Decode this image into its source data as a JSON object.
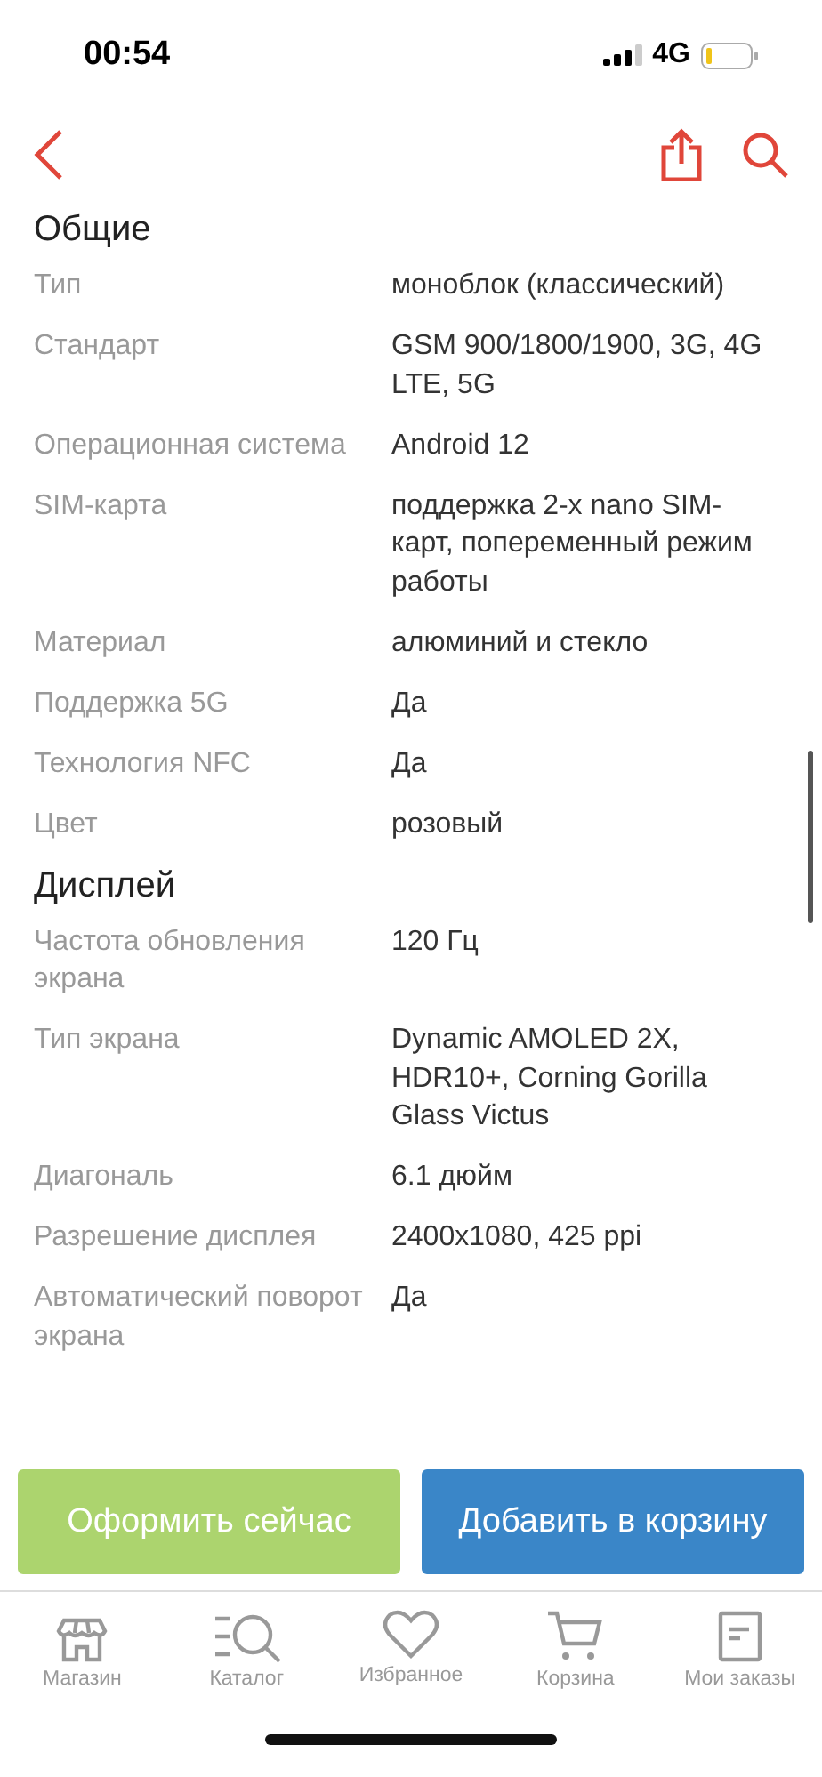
{
  "status_bar": {
    "time": "00:54",
    "network": "4G"
  },
  "sections": [
    {
      "title": "Общие",
      "rows": [
        {
          "label": "Тип",
          "value": "моноблок (классический)"
        },
        {
          "label": "Стандарт",
          "value": "GSM 900/1800/1900, 3G, 4G LTE, 5G"
        },
        {
          "label": "Операционная система",
          "value": "Android 12"
        },
        {
          "label": "SIM-карта",
          "value": "поддержка 2-x nano SIM-карт, попеременный режим работы"
        },
        {
          "label": "Материал",
          "value": "алюминий и стекло"
        },
        {
          "label": "Поддержка 5G",
          "value": "Да"
        },
        {
          "label": "Технология NFC",
          "value": "Да"
        },
        {
          "label": "Цвет",
          "value": "розовый"
        }
      ]
    },
    {
      "title": "Дисплей",
      "rows": [
        {
          "label": "Частота обновления экрана",
          "value": "120 Гц"
        },
        {
          "label": "Тип экрана",
          "value": "Dynamic AMOLED 2X, HDR10+, Corning Gorilla Glass Victus"
        },
        {
          "label": "Диагональ",
          "value": "6.1 дюйм"
        },
        {
          "label": "Разрешение дисплея",
          "value": "2400x1080, 425 ppi"
        },
        {
          "label": "Автоматический поворот экрана",
          "value": "Да"
        }
      ]
    }
  ],
  "buttons": [
    {
      "label": "Оформить сейчас",
      "kind": "buy"
    },
    {
      "label": "Добавить в корзину",
      "kind": "cart"
    }
  ],
  "tab_bar": [
    {
      "label": "Магазин",
      "kind": "shop"
    },
    {
      "label": "Каталог",
      "kind": "catalog"
    },
    {
      "label": "Избранное",
      "kind": "favorites"
    },
    {
      "label": "Корзина",
      "kind": "cart"
    },
    {
      "label": "Мои заказы",
      "kind": "orders"
    }
  ]
}
